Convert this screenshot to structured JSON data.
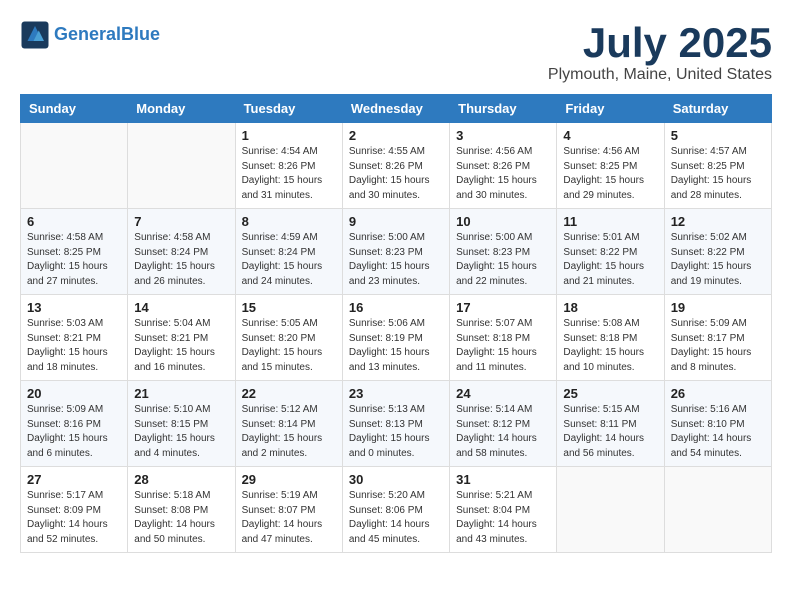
{
  "logo": {
    "line1": "General",
    "line2": "Blue"
  },
  "title": "July 2025",
  "location": "Plymouth, Maine, United States",
  "weekdays": [
    "Sunday",
    "Monday",
    "Tuesday",
    "Wednesday",
    "Thursday",
    "Friday",
    "Saturday"
  ],
  "weeks": [
    [
      {
        "day": "",
        "info": ""
      },
      {
        "day": "",
        "info": ""
      },
      {
        "day": "1",
        "info": "Sunrise: 4:54 AM\nSunset: 8:26 PM\nDaylight: 15 hours\nand 31 minutes."
      },
      {
        "day": "2",
        "info": "Sunrise: 4:55 AM\nSunset: 8:26 PM\nDaylight: 15 hours\nand 30 minutes."
      },
      {
        "day": "3",
        "info": "Sunrise: 4:56 AM\nSunset: 8:26 PM\nDaylight: 15 hours\nand 30 minutes."
      },
      {
        "day": "4",
        "info": "Sunrise: 4:56 AM\nSunset: 8:25 PM\nDaylight: 15 hours\nand 29 minutes."
      },
      {
        "day": "5",
        "info": "Sunrise: 4:57 AM\nSunset: 8:25 PM\nDaylight: 15 hours\nand 28 minutes."
      }
    ],
    [
      {
        "day": "6",
        "info": "Sunrise: 4:58 AM\nSunset: 8:25 PM\nDaylight: 15 hours\nand 27 minutes."
      },
      {
        "day": "7",
        "info": "Sunrise: 4:58 AM\nSunset: 8:24 PM\nDaylight: 15 hours\nand 26 minutes."
      },
      {
        "day": "8",
        "info": "Sunrise: 4:59 AM\nSunset: 8:24 PM\nDaylight: 15 hours\nand 24 minutes."
      },
      {
        "day": "9",
        "info": "Sunrise: 5:00 AM\nSunset: 8:23 PM\nDaylight: 15 hours\nand 23 minutes."
      },
      {
        "day": "10",
        "info": "Sunrise: 5:00 AM\nSunset: 8:23 PM\nDaylight: 15 hours\nand 22 minutes."
      },
      {
        "day": "11",
        "info": "Sunrise: 5:01 AM\nSunset: 8:22 PM\nDaylight: 15 hours\nand 21 minutes."
      },
      {
        "day": "12",
        "info": "Sunrise: 5:02 AM\nSunset: 8:22 PM\nDaylight: 15 hours\nand 19 minutes."
      }
    ],
    [
      {
        "day": "13",
        "info": "Sunrise: 5:03 AM\nSunset: 8:21 PM\nDaylight: 15 hours\nand 18 minutes."
      },
      {
        "day": "14",
        "info": "Sunrise: 5:04 AM\nSunset: 8:21 PM\nDaylight: 15 hours\nand 16 minutes."
      },
      {
        "day": "15",
        "info": "Sunrise: 5:05 AM\nSunset: 8:20 PM\nDaylight: 15 hours\nand 15 minutes."
      },
      {
        "day": "16",
        "info": "Sunrise: 5:06 AM\nSunset: 8:19 PM\nDaylight: 15 hours\nand 13 minutes."
      },
      {
        "day": "17",
        "info": "Sunrise: 5:07 AM\nSunset: 8:18 PM\nDaylight: 15 hours\nand 11 minutes."
      },
      {
        "day": "18",
        "info": "Sunrise: 5:08 AM\nSunset: 8:18 PM\nDaylight: 15 hours\nand 10 minutes."
      },
      {
        "day": "19",
        "info": "Sunrise: 5:09 AM\nSunset: 8:17 PM\nDaylight: 15 hours\nand 8 minutes."
      }
    ],
    [
      {
        "day": "20",
        "info": "Sunrise: 5:09 AM\nSunset: 8:16 PM\nDaylight: 15 hours\nand 6 minutes."
      },
      {
        "day": "21",
        "info": "Sunrise: 5:10 AM\nSunset: 8:15 PM\nDaylight: 15 hours\nand 4 minutes."
      },
      {
        "day": "22",
        "info": "Sunrise: 5:12 AM\nSunset: 8:14 PM\nDaylight: 15 hours\nand 2 minutes."
      },
      {
        "day": "23",
        "info": "Sunrise: 5:13 AM\nSunset: 8:13 PM\nDaylight: 15 hours\nand 0 minutes."
      },
      {
        "day": "24",
        "info": "Sunrise: 5:14 AM\nSunset: 8:12 PM\nDaylight: 14 hours\nand 58 minutes."
      },
      {
        "day": "25",
        "info": "Sunrise: 5:15 AM\nSunset: 8:11 PM\nDaylight: 14 hours\nand 56 minutes."
      },
      {
        "day": "26",
        "info": "Sunrise: 5:16 AM\nSunset: 8:10 PM\nDaylight: 14 hours\nand 54 minutes."
      }
    ],
    [
      {
        "day": "27",
        "info": "Sunrise: 5:17 AM\nSunset: 8:09 PM\nDaylight: 14 hours\nand 52 minutes."
      },
      {
        "day": "28",
        "info": "Sunrise: 5:18 AM\nSunset: 8:08 PM\nDaylight: 14 hours\nand 50 minutes."
      },
      {
        "day": "29",
        "info": "Sunrise: 5:19 AM\nSunset: 8:07 PM\nDaylight: 14 hours\nand 47 minutes."
      },
      {
        "day": "30",
        "info": "Sunrise: 5:20 AM\nSunset: 8:06 PM\nDaylight: 14 hours\nand 45 minutes."
      },
      {
        "day": "31",
        "info": "Sunrise: 5:21 AM\nSunset: 8:04 PM\nDaylight: 14 hours\nand 43 minutes."
      },
      {
        "day": "",
        "info": ""
      },
      {
        "day": "",
        "info": ""
      }
    ]
  ]
}
